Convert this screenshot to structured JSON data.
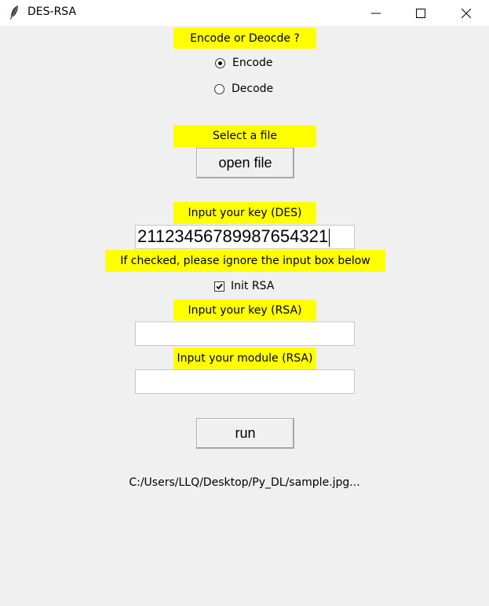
{
  "window": {
    "title": "DES-RSA"
  },
  "mode": {
    "prompt": "Encode or Deocde ?",
    "options": [
      {
        "label": "Encode",
        "selected": true
      },
      {
        "label": "Decode",
        "selected": false
      }
    ]
  },
  "file": {
    "prompt": "Select a file",
    "button_label": "open file"
  },
  "des": {
    "prompt": "Input your key (DES)",
    "key_value": "21123456789987654321"
  },
  "rsa": {
    "hint": "If checked, please ignore the input box below",
    "init_label": "Init RSA",
    "init_checked": true,
    "key_prompt": "Input your key (RSA)",
    "key_value": "",
    "module_prompt": "Input your module (RSA)",
    "module_value": ""
  },
  "run": {
    "button_label": "run"
  },
  "status": {
    "path": "C:/Users/LLQ/Desktop/Py_DL/sample.jpg..."
  },
  "colors": {
    "label_bg": "#ffff00",
    "window_bg": "#f0f0f0"
  },
  "icons": [
    "feather-icon",
    "minimize-icon",
    "maximize-icon",
    "close-icon",
    "radio-checked-icon",
    "radio-unchecked-icon",
    "checkbox-checked-icon"
  ]
}
